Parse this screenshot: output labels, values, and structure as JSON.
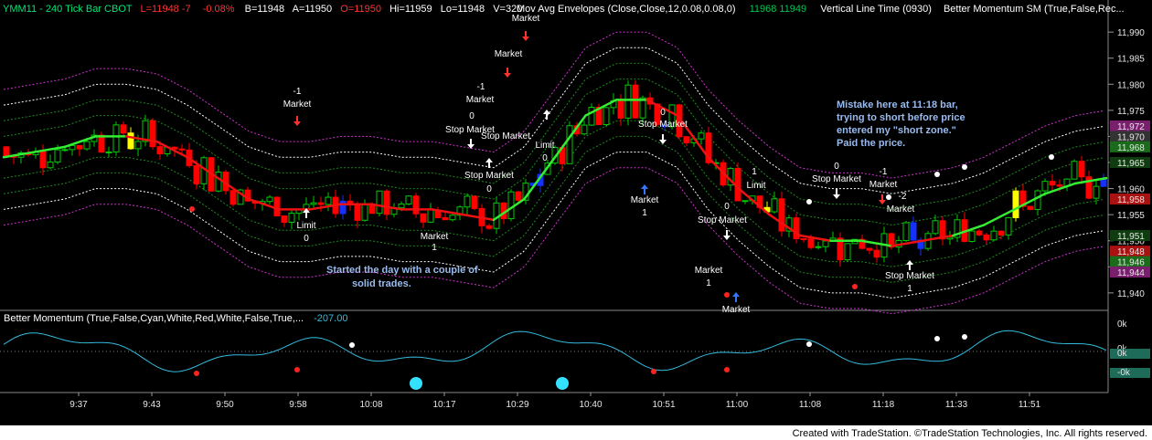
{
  "header": {
    "symbol": "YMM11 - 240 Tick Bar  CBOT",
    "last": "L=11948 -7",
    "last_pct": "-0.08%",
    "bid": "B=11948",
    "ask": "A=11950",
    "open": "O=11950",
    "high": "Hi=11959",
    "low": "Lo=11948",
    "volume": "V=320",
    "envelope_study": "Mov Avg Envelopes (Close,Close,12,0.08,0.08,0)",
    "envelope_values": "11968   11949",
    "vertical_line_study": "Vertical Line Time (0930)",
    "momentum_sm_study": "Better Momentum SM (True,False,Rec..."
  },
  "subpanel": {
    "study": "Better Momentum (True,False,Cyan,White,Red,White,False,True,...",
    "value": "-207.00",
    "axis_labels": [
      "0k",
      "0k",
      "0k",
      "-0k"
    ]
  },
  "price_axis": {
    "ticks": [
      "11,990",
      "11,985",
      "11,980",
      "11,975",
      "11,970",
      "11,965",
      "11,960",
      "11,955",
      "11,950",
      "11,945",
      "11,940"
    ],
    "markers": [
      {
        "label": "11,972",
        "color": "#7a1f6e"
      },
      {
        "label": "11,970",
        "color": "#333333"
      },
      {
        "label": "11,968",
        "color": "#1a6b1a"
      },
      {
        "label": "11,965",
        "color": "#0f3d0f"
      },
      {
        "label": "11,958",
        "color": "#aa1111"
      },
      {
        "label": "11,951",
        "color": "#0f3d0f"
      },
      {
        "label": "11,948",
        "color": "#aa1111"
      },
      {
        "label": "11,946",
        "color": "#1a6b1a"
      },
      {
        "label": "11,944",
        "color": "#7a1f6e"
      }
    ]
  },
  "chart_data": {
    "type": "candlestick",
    "x_ticks": [
      "9:37",
      "9:43",
      "9:50",
      "9:58",
      "10:08",
      "10:17",
      "10:29",
      "10:40",
      "10:51",
      "11:00",
      "11:08",
      "11:18",
      "11:33",
      "11:51"
    ],
    "ylim": [
      11937,
      11993
    ],
    "moving_average": [
      11966,
      11967,
      11968,
      11970,
      11970,
      11969,
      11966,
      11962,
      11958,
      11956,
      11956,
      11957,
      11957,
      11956,
      11956,
      11955,
      11954,
      11958,
      11966,
      11974,
      11977,
      11977,
      11974,
      11966,
      11960,
      11955,
      11951,
      11950,
      11950,
      11949,
      11950,
      11951,
      11953,
      11956,
      11959,
      11961,
      11962
    ],
    "ma_colors": [
      "green",
      "green",
      "green",
      "green",
      "red",
      "red",
      "red",
      "red",
      "red",
      "red",
      "red",
      "red",
      "red",
      "red",
      "red",
      "red",
      "green",
      "green",
      "green",
      "green",
      "green",
      "red",
      "red",
      "red",
      "red",
      "red",
      "red",
      "green",
      "green",
      "red",
      "red",
      "green",
      "green",
      "green",
      "green",
      "green",
      "green"
    ]
  },
  "annotations": {
    "note_start": [
      "Started the day with a couple of",
      "solid trades."
    ],
    "note_mistake": [
      "Mistake here at 11:18 bar,",
      "trying to short before price",
      "entered my \"short zone.\"",
      "Paid the price."
    ],
    "trade_labels": [
      {
        "text": "-1",
        "x": 325,
        "y": 103
      },
      {
        "text": "Market",
        "x": 325,
        "y": 117
      },
      {
        "text": "Limit",
        "x": 335,
        "y": 250
      },
      {
        "text": "0",
        "x": 335,
        "y": 264
      },
      {
        "text": "Market",
        "x": 475,
        "y": 262
      },
      {
        "text": "1",
        "x": 475,
        "y": 274
      },
      {
        "text": "Stop Market",
        "x": 514,
        "y": 145
      },
      {
        "text": "0",
        "x": 516,
        "y": 130
      },
      {
        "text": "Market",
        "x": 525,
        "y": 112
      },
      {
        "text": "-1",
        "x": 526,
        "y": 98
      },
      {
        "text": "Market",
        "x": 556,
        "y": 62
      },
      {
        "text": "Market",
        "x": 575,
        "y": 23
      },
      {
        "text": "Stop Market",
        "x": 553,
        "y": 152
      },
      {
        "text": "Stop Market",
        "x": 535,
        "y": 195
      },
      {
        "text": "0",
        "x": 535,
        "y": 210
      },
      {
        "text": "Limit",
        "x": 596,
        "y": 162
      },
      {
        "text": "0",
        "x": 596,
        "y": 176
      },
      {
        "text": "0",
        "x": 725,
        "y": 126
      },
      {
        "text": "Stop Market",
        "x": 725,
        "y": 139
      },
      {
        "text": "Market",
        "x": 705,
        "y": 222
      },
      {
        "text": "1",
        "x": 705,
        "y": 236
      },
      {
        "text": "0",
        "x": 795,
        "y": 229
      },
      {
        "text": "Stop Market",
        "x": 790,
        "y": 244
      },
      {
        "text": "1",
        "x": 825,
        "y": 191
      },
      {
        "text": "Limit",
        "x": 827,
        "y": 206
      },
      {
        "text": "Market",
        "x": 775,
        "y": 299
      },
      {
        "text": "1",
        "x": 775,
        "y": 313
      },
      {
        "text": "Market",
        "x": 805,
        "y": 342
      },
      {
        "text": "0",
        "x": 915,
        "y": 185
      },
      {
        "text": "Stop Market",
        "x": 915,
        "y": 199
      },
      {
        "text": "-1",
        "x": 966,
        "y": 191
      },
      {
        "text": "Market",
        "x": 966,
        "y": 205
      },
      {
        "text": "-2",
        "x": 987,
        "y": 218
      },
      {
        "text": "Market",
        "x": 985,
        "y": 232
      },
      {
        "text": "Stop Market",
        "x": 995,
        "y": 305
      },
      {
        "text": "1",
        "x": 995,
        "y": 319
      }
    ]
  },
  "footer": {
    "credit": "Created with TradeStation. ©TradeStation Technologies, Inc. All rights reserved."
  },
  "colors": {
    "background": "#000000",
    "up_candle": "#00cc00",
    "down_candle": "#ff0000",
    "paint_blue": "#1530ff",
    "paint_yellow": "#ffff00",
    "ma_up": "#33ee33",
    "ma_down": "#ee1111",
    "band_outer": "#cc33cc",
    "band_mid": "#ffffff",
    "band_inner": "#1f8a1f",
    "momentum": "#33bbdd",
    "note": "#99bbee"
  }
}
